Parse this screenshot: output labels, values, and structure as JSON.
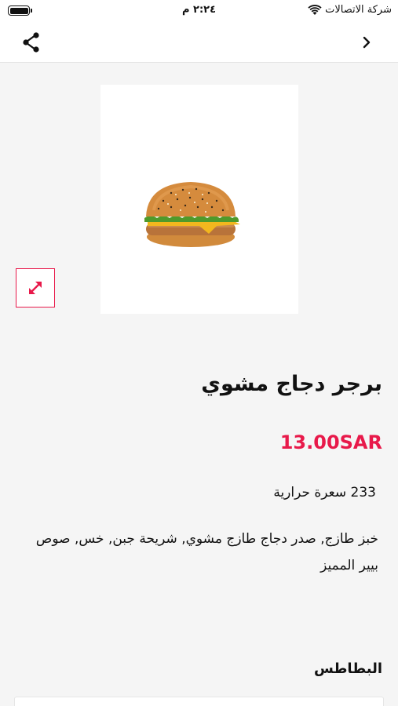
{
  "status_bar": {
    "carrier": "شركة الاتصالات",
    "time": "٢:٢٤ م",
    "battery_level": 1.0
  },
  "nav": {
    "share_icon": "share-icon",
    "back_icon": "chevron-right-icon"
  },
  "product": {
    "image_alt": "burger-image",
    "title": "برجر دجاج مشوي",
    "price": "13.00SAR",
    "calories": "233 سعرة حرارية",
    "description": "خبز طازج, صدر دجاج طازج مشوي, شريحة جبن, خس, صوص بيير المميز",
    "expand_icon": "expand-icon"
  },
  "options": {
    "section_title": "البطاطس"
  },
  "colors": {
    "accent": "#e8194a",
    "background": "#f5f5f5",
    "card": "#ffffff"
  }
}
